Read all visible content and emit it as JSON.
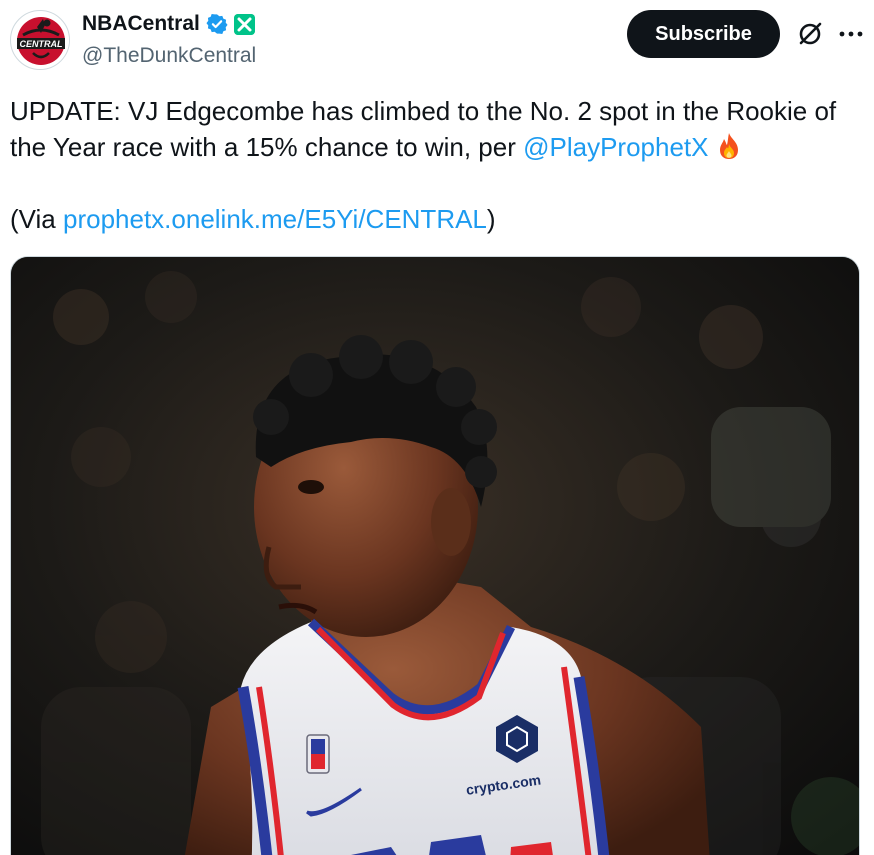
{
  "account": {
    "display_name": "NBACentral",
    "handle": "@TheDunkCentral",
    "avatar_text": "CENTRAL",
    "verified_icon": "verified-badge-icon",
    "affiliate_icon": "affiliate-badge-icon"
  },
  "actions": {
    "subscribe_label": "Subscribe",
    "grok_icon": "grok-icon",
    "more_icon": "more-icon"
  },
  "tweet": {
    "line1": "UPDATE: VJ Edgecombe has climbed to the No. 2 spot in the Rookie of",
    "line2_prefix": "the Year race with a 15% chance to win, per ",
    "mention": "@PlayProphetX",
    "emoji": "fire-icon",
    "via_open": "(Via ",
    "via_link": "prophetx.onelink.me/E5Yi/CENTRAL",
    "via_close": ")"
  },
  "media": {
    "jersey_text": "crypto.com"
  },
  "colors": {
    "link": "#1d9bf0",
    "subscribe_bg": "#0f1419",
    "verified": "#1d9bf0",
    "affiliate": "#00c389",
    "jersey_red": "#e0262e",
    "jersey_blue": "#2a3b9e"
  }
}
